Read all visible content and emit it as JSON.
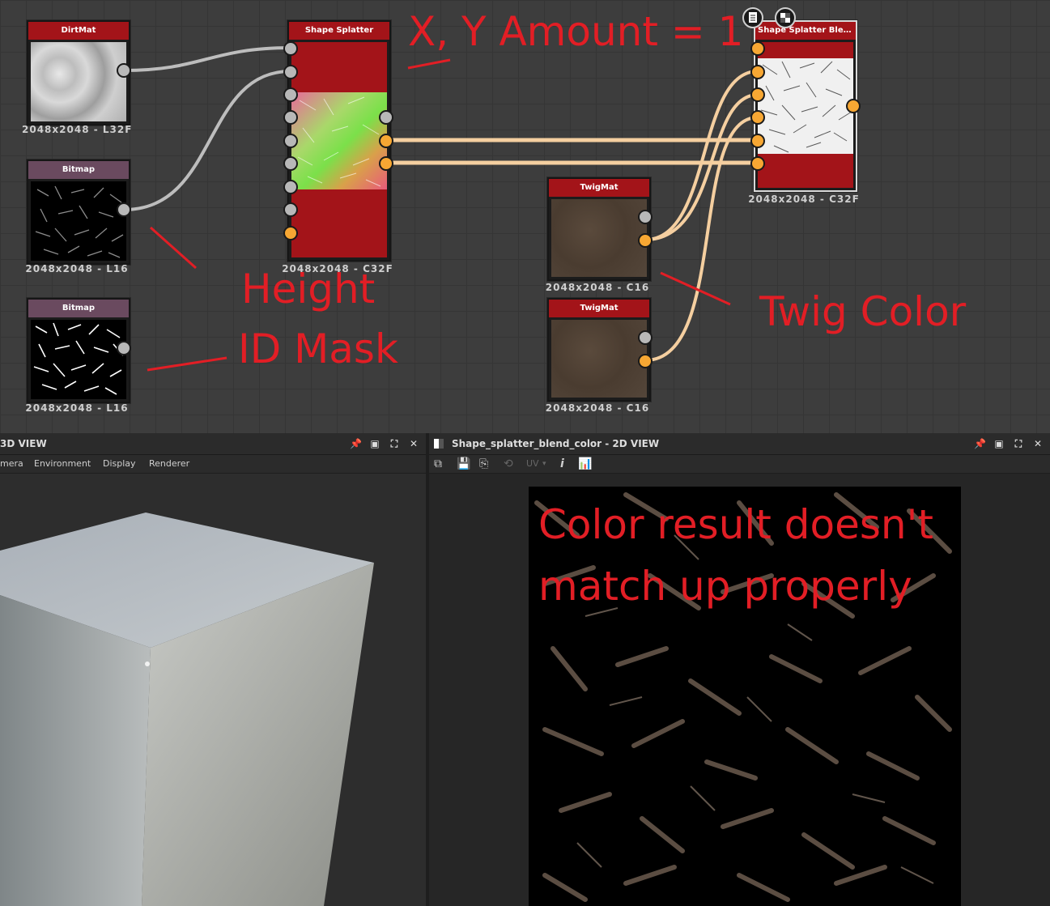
{
  "graph": {
    "nodes": {
      "dirtmat": {
        "title": "DirtMat",
        "resolution": "2048x2048 - L32F"
      },
      "bitmap_height": {
        "title": "Bitmap",
        "resolution": "2048x2048 - L16"
      },
      "bitmap_idmask": {
        "title": "Bitmap",
        "resolution": "2048x2048 - L16"
      },
      "shape_splatter": {
        "title": "Shape Splatter",
        "resolution": "2048x2048 - C32F"
      },
      "twigmat_1": {
        "title": "TwigMat",
        "resolution": "2048x2048 - C16"
      },
      "twigmat_2": {
        "title": "TwigMat",
        "resolution": "2048x2048 - C16"
      },
      "shape_splatter_blend": {
        "title": "Shape Splatter Blend C...",
        "resolution": "2048x2048 - C32F"
      }
    },
    "node_icons": [
      "document-icon",
      "checker-icon"
    ]
  },
  "annotations": {
    "xy_amount": "X, Y Amount = 1",
    "height": "Height",
    "id_mask": "ID Mask",
    "twig_color": "Twig Color",
    "color_result_line1": "Color result doesn't",
    "color_result_line2": "match up properly"
  },
  "view3d": {
    "title": "3D VIEW",
    "menu": [
      "mera",
      "Environment",
      "Display",
      "Renderer"
    ]
  },
  "view2d": {
    "title": "Shape_splatter_blend_color - 2D VIEW",
    "toolbar_uv": "UV",
    "toolbar_info": "i"
  },
  "colors": {
    "accent_red": "#a31419",
    "annotation_red": "#e21e25",
    "pin_orange": "#f7a733",
    "pin_gray": "#b8b8b8",
    "wire_gray": "#bdbdbd",
    "wire_orange": "#f5cfa0"
  }
}
